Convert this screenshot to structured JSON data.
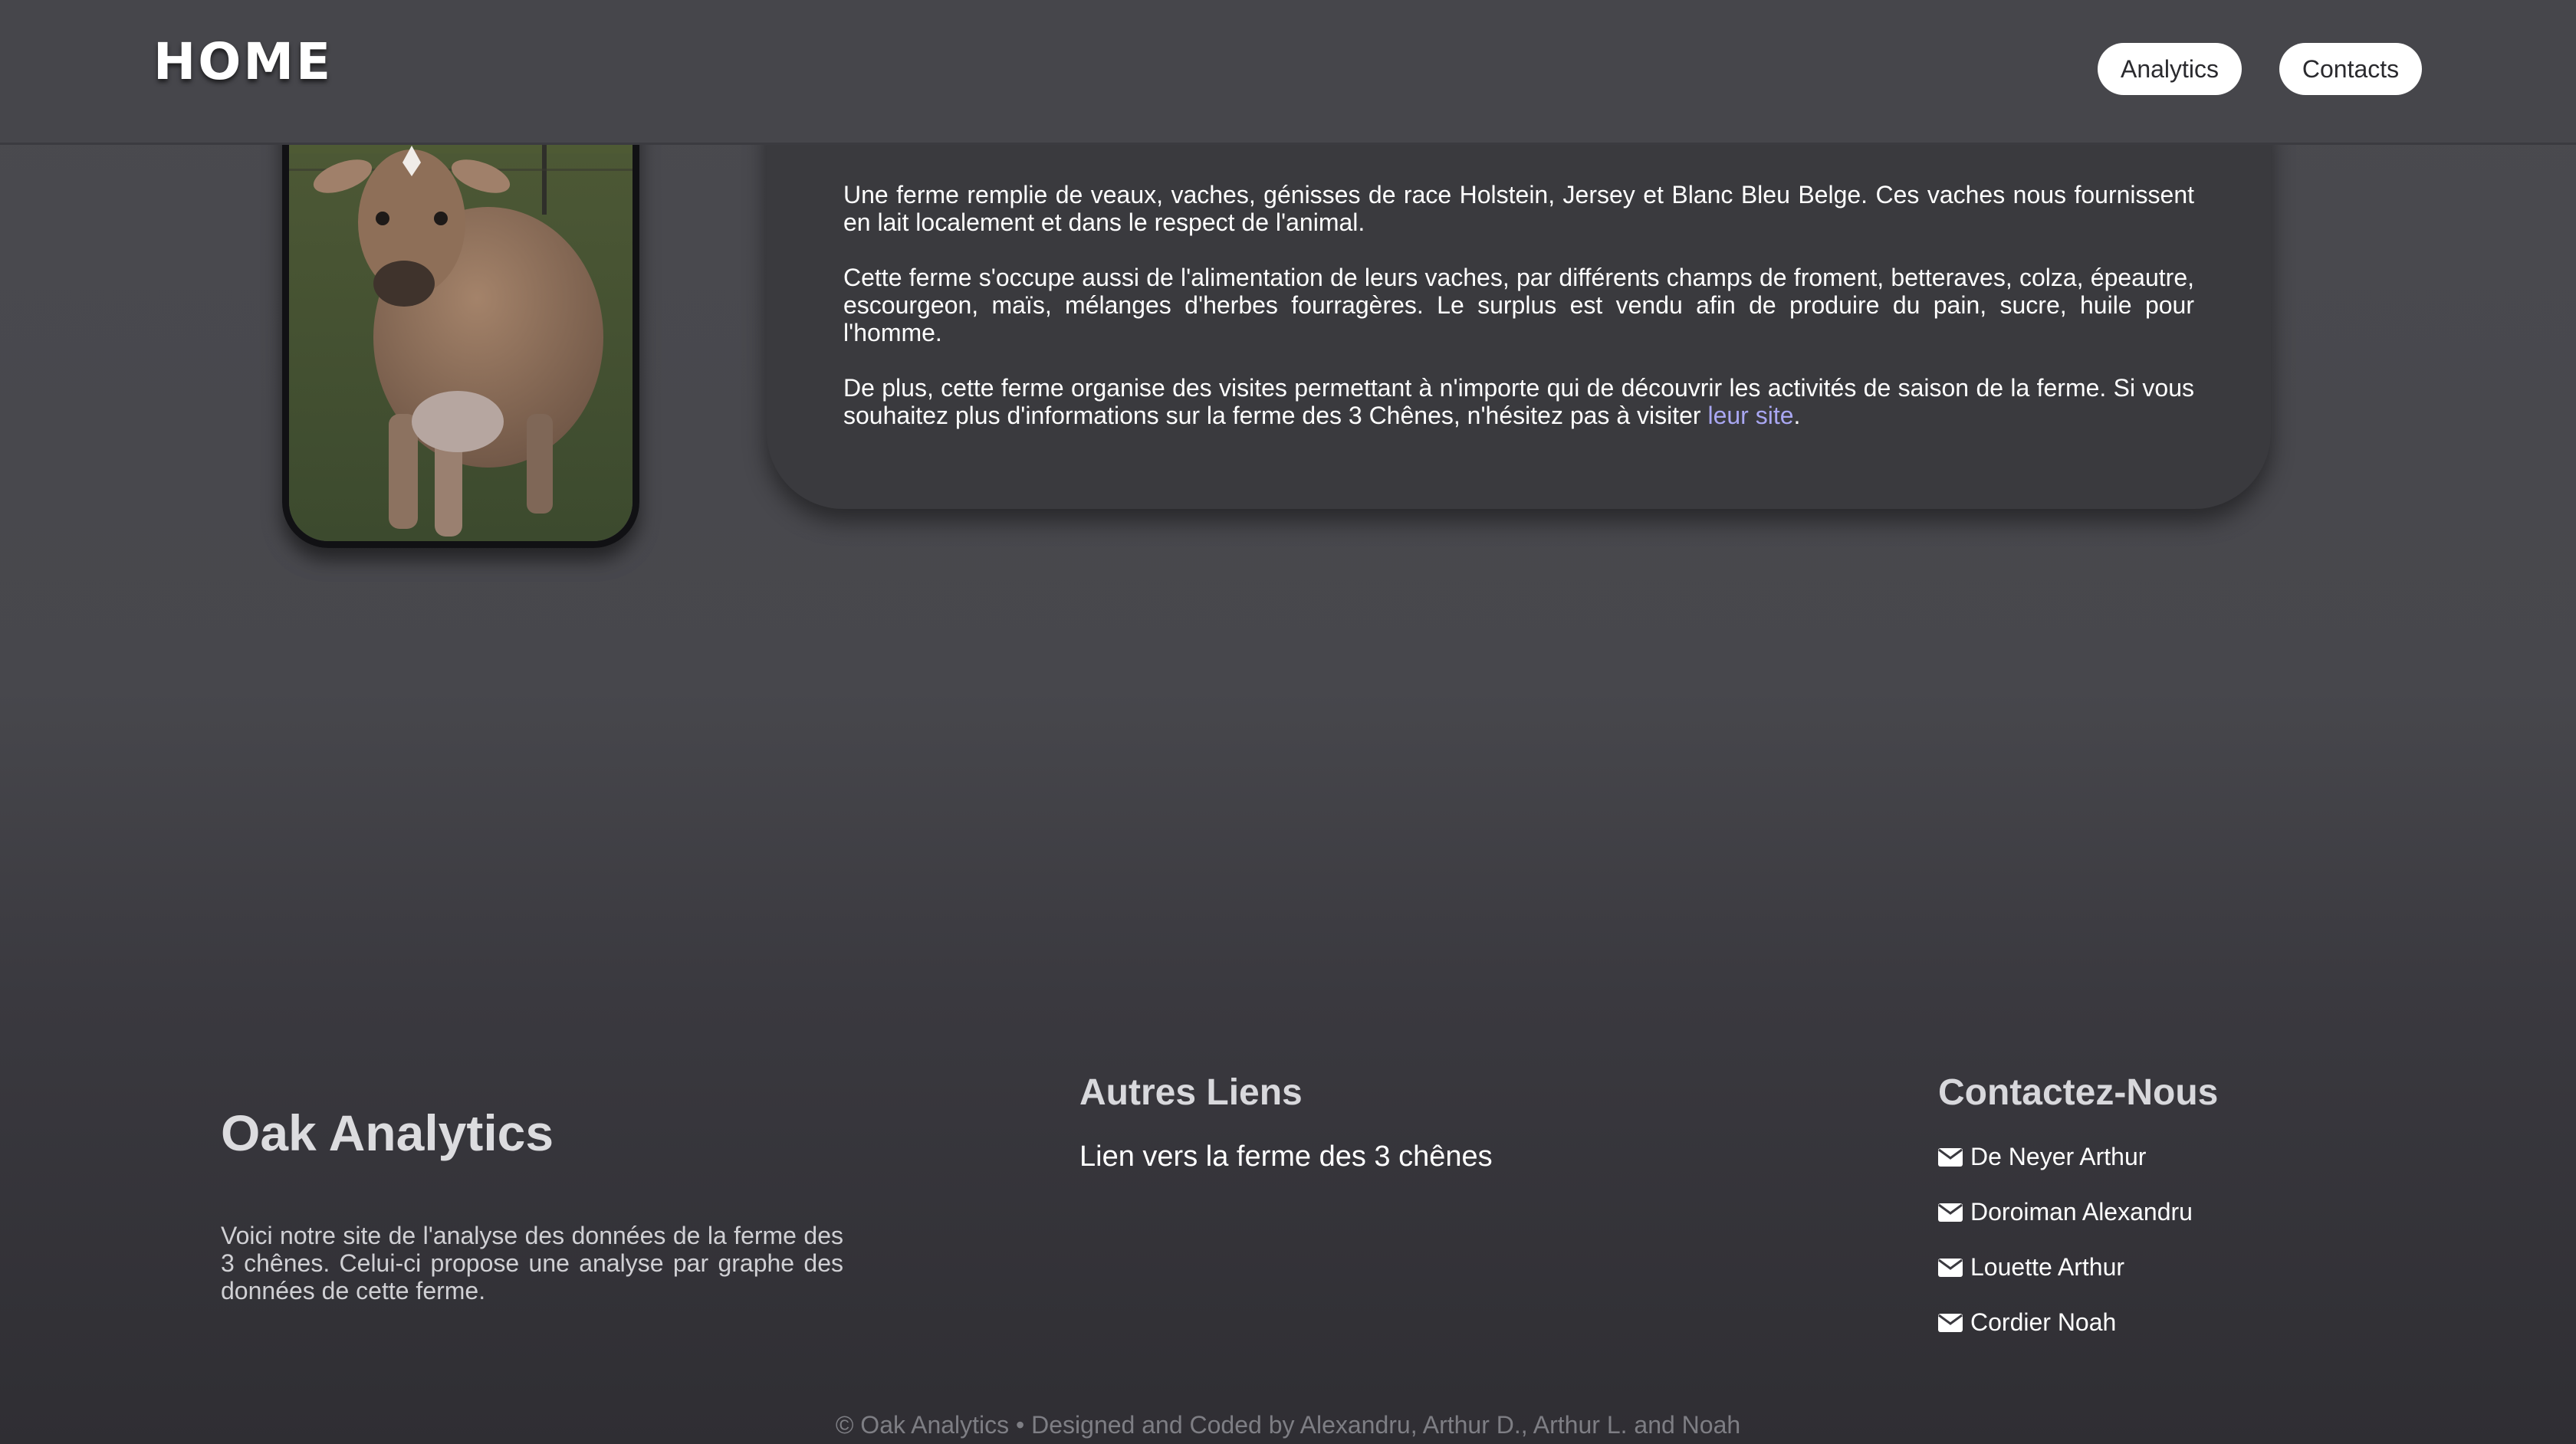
{
  "header": {
    "brand": "HOME",
    "nav": [
      {
        "label": "Analytics"
      },
      {
        "label": "Contacts"
      }
    ]
  },
  "intro": {
    "p1": "Une ferme remplie de veaux, vaches, génisses de race Holstein, Jersey et Blanc Bleu Belge. Ces vaches nous fournissent en lait localement et dans le respect de l'animal.",
    "p2": "Cette ferme s'occupe aussi de l'alimentation de leurs vaches, par différents champs de froment, betteraves, colza, épeautre, escourgeon, maïs, mélanges d'herbes fourragères. Le surplus est vendu afin de produire du pain, sucre, huile pour l'homme.",
    "p3_text": "De plus, cette ferme organise des visites permettant à n'importe qui de découvrir les activités de saison de la ferme. Si vous souhaitez plus d'informations sur la ferme des 3 Chênes, n'hésitez pas à visiter ",
    "p3_link": "leur site",
    "p3_end": "."
  },
  "footer": {
    "title": "Oak Analytics",
    "description": "Voici notre site de l'analyse des données de la ferme des 3 chênes. Celui-ci propose une analyse par graphe des données de cette ferme.",
    "links_heading": "Autres Liens",
    "link": "Lien vers la ferme des 3 chênes",
    "contact_heading": "Contactez-Nous",
    "contacts": [
      "De Neyer Arthur",
      "Doroiman Alexandru",
      "Louette Arthur",
      "Cordier Noah"
    ],
    "copyright": "© Oak Analytics • Designed and Coded by Alexandru, Arthur D., Arthur L. and Noah"
  },
  "colors": {
    "accent_link": "#a9a7f2",
    "card": "#3a3a3e",
    "header": "#46464b"
  },
  "icons": [
    "envelope-icon",
    "cow-photo"
  ]
}
